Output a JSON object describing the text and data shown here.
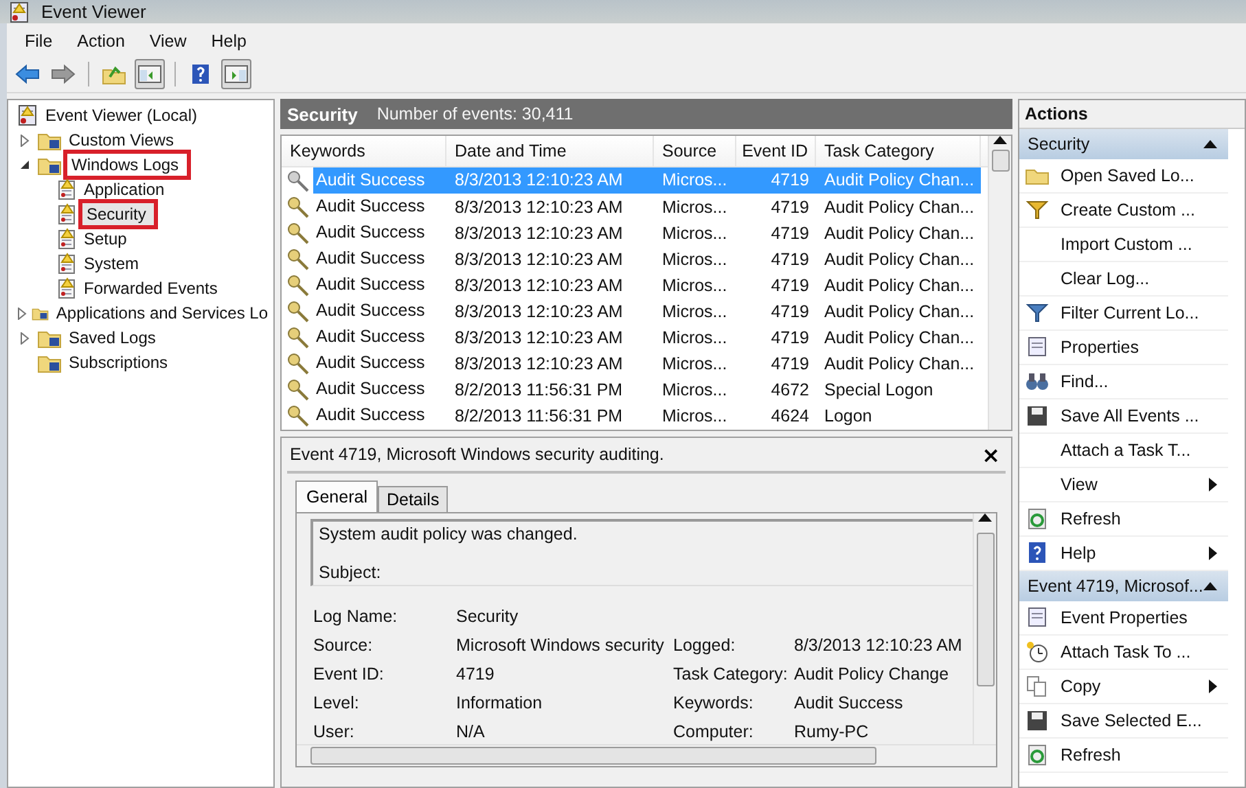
{
  "window": {
    "title": "Event Viewer"
  },
  "menu": [
    "File",
    "Action",
    "View",
    "Help"
  ],
  "tree": [
    {
      "label": "Event Viewer (Local)",
      "highlighted": false,
      "selected": false,
      "children": [
        {
          "label": "Custom Views",
          "expanded": false,
          "highlighted": false,
          "selected": false
        },
        {
          "label": "Windows Logs",
          "expanded": true,
          "highlighted": true,
          "selected": false,
          "children": [
            {
              "label": "Application",
              "highlighted": false,
              "selected": false
            },
            {
              "label": "Security",
              "highlighted": true,
              "selected": true
            },
            {
              "label": "Setup",
              "highlighted": false,
              "selected": false
            },
            {
              "label": "System",
              "highlighted": false,
              "selected": false
            },
            {
              "label": "Forwarded Events",
              "highlighted": false,
              "selected": false
            }
          ]
        },
        {
          "label": "Applications and Services Lo",
          "expanded": false,
          "highlighted": false,
          "selected": false
        },
        {
          "label": "Saved Logs",
          "expanded": false,
          "highlighted": false,
          "selected": false
        },
        {
          "label": "Subscriptions",
          "highlighted": false,
          "selected": false
        }
      ]
    }
  ],
  "log_header": {
    "title": "Security",
    "count": "Number of events: 30,411"
  },
  "table": {
    "columns": [
      "Keywords",
      "Date and Time",
      "Source",
      "Event ID",
      "Task Category"
    ],
    "rows": [
      {
        "selected": true,
        "cells": [
          "Audit Success",
          "8/3/2013 12:10:23 AM",
          "Micros...",
          "4719",
          "Audit Policy Chan..."
        ]
      },
      {
        "selected": false,
        "cells": [
          "Audit Success",
          "8/3/2013 12:10:23 AM",
          "Micros...",
          "4719",
          "Audit Policy Chan..."
        ]
      },
      {
        "selected": false,
        "cells": [
          "Audit Success",
          "8/3/2013 12:10:23 AM",
          "Micros...",
          "4719",
          "Audit Policy Chan..."
        ]
      },
      {
        "selected": false,
        "cells": [
          "Audit Success",
          "8/3/2013 12:10:23 AM",
          "Micros...",
          "4719",
          "Audit Policy Chan..."
        ]
      },
      {
        "selected": false,
        "cells": [
          "Audit Success",
          "8/3/2013 12:10:23 AM",
          "Micros...",
          "4719",
          "Audit Policy Chan..."
        ]
      },
      {
        "selected": false,
        "cells": [
          "Audit Success",
          "8/3/2013 12:10:23 AM",
          "Micros...",
          "4719",
          "Audit Policy Chan..."
        ]
      },
      {
        "selected": false,
        "cells": [
          "Audit Success",
          "8/3/2013 12:10:23 AM",
          "Micros...",
          "4719",
          "Audit Policy Chan..."
        ]
      },
      {
        "selected": false,
        "cells": [
          "Audit Success",
          "8/3/2013 12:10:23 AM",
          "Micros...",
          "4719",
          "Audit Policy Chan..."
        ]
      },
      {
        "selected": false,
        "cells": [
          "Audit Success",
          "8/2/2013 11:56:31 PM",
          "Micros...",
          "4672",
          "Special Logon"
        ]
      },
      {
        "selected": false,
        "cells": [
          "Audit Success",
          "8/2/2013 11:56:31 PM",
          "Micros...",
          "4624",
          "Logon"
        ]
      }
    ]
  },
  "event_panel": {
    "title": "Event 4719, Microsoft Windows security auditing.",
    "close": "×",
    "tabs": [
      {
        "label": "General",
        "selected": true
      },
      {
        "label": "Details",
        "selected": false
      }
    ],
    "message": [
      "System audit policy was changed.",
      "Subject:"
    ],
    "fields": [
      [
        {
          "label": "Log Name:",
          "value": "Security"
        }
      ],
      [
        {
          "label": "Source:",
          "value": "Microsoft Windows security"
        },
        {
          "label": "Logged:",
          "value": "8/3/2013 12:10:23 AM"
        }
      ],
      [
        {
          "label": "Event ID:",
          "value": "4719"
        },
        {
          "label": "Task Category:",
          "value": "Audit Policy Change"
        }
      ],
      [
        {
          "label": "Level:",
          "value": "Information"
        },
        {
          "label": "Keywords:",
          "value": "Audit Success"
        }
      ],
      [
        {
          "label": "User:",
          "value": "N/A"
        },
        {
          "label": "Computer:",
          "value": "Rumy-PC"
        }
      ]
    ]
  },
  "actions": {
    "title": "Actions",
    "items": [
      {
        "kind": "section",
        "label": "Security",
        "expanded": true
      },
      {
        "kind": "item",
        "label": "Open Saved Lo...",
        "submenu": false
      },
      {
        "kind": "item",
        "label": "Create Custom ...",
        "submenu": false
      },
      {
        "kind": "item",
        "label": "Import Custom ...",
        "submenu": false
      },
      {
        "kind": "item",
        "label": "Clear Log...",
        "submenu": false
      },
      {
        "kind": "item",
        "label": "Filter Current Lo...",
        "submenu": false
      },
      {
        "kind": "item",
        "label": "Properties",
        "submenu": false
      },
      {
        "kind": "item",
        "label": "Find...",
        "submenu": false
      },
      {
        "kind": "item",
        "label": "Save All Events ...",
        "submenu": false
      },
      {
        "kind": "item",
        "label": "Attach a Task T...",
        "submenu": false
      },
      {
        "kind": "item",
        "label": "View",
        "submenu": true
      },
      {
        "kind": "item",
        "label": "Refresh",
        "submenu": false
      },
      {
        "kind": "item",
        "label": "Help",
        "submenu": true
      },
      {
        "kind": "section",
        "label": "Event 4719, Microsof...",
        "expanded": true
      },
      {
        "kind": "item",
        "label": "Event Properties",
        "submenu": false
      },
      {
        "kind": "item",
        "label": "Attach Task To ...",
        "submenu": false
      },
      {
        "kind": "item",
        "label": "Copy",
        "submenu": true
      },
      {
        "kind": "item",
        "label": "Save Selected E...",
        "submenu": false
      },
      {
        "kind": "item",
        "label": "Refresh",
        "submenu": false
      }
    ]
  }
}
